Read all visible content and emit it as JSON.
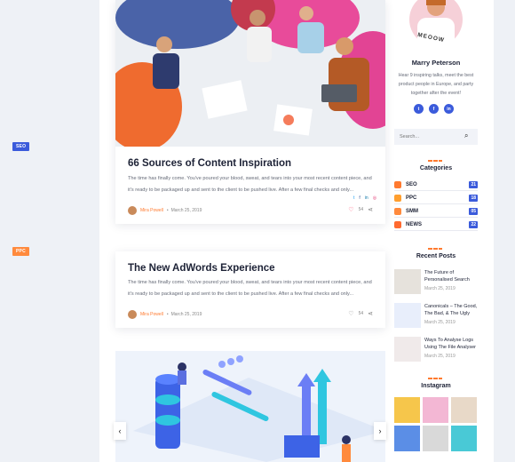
{
  "posts": [
    {
      "category": "SEO",
      "title": "66 Sources of Content Inspiration",
      "excerpt": "The time has finally come. You've poured your blood, sweat, and tears into your most recent content piece, and it's ready to be packaged up and sent to the client to be pushed live. After a few final checks and only...",
      "author": "Mira Powell",
      "date": "March 25, 2019",
      "likes": "54"
    },
    {
      "category": "PPC",
      "title": "The New AdWords Experience",
      "excerpt": "The time has finally come. You've poured your blood, sweat, and tears into your most recent content piece, and it's ready to be packaged up and sent to the client to be pushed live. After a few final checks and only...",
      "author": "Mira Powell",
      "date": "March 25, 2019",
      "likes": "54"
    }
  ],
  "profile": {
    "name": "Marry Peterson",
    "bio": "Hear 9 inspiring talks, meet the best product people in Europe, and party together after the event!",
    "shirt_text": "MEOOW"
  },
  "search": {
    "placeholder": "Search..."
  },
  "categories_title": "Categories",
  "categories": [
    {
      "label": "SEO",
      "count": "21",
      "color": "#ff7a2f"
    },
    {
      "label": "PPC",
      "count": "18",
      "color": "#ff9f2f"
    },
    {
      "label": "SMM",
      "count": "05",
      "color": "#ff8a3d"
    },
    {
      "label": "NEWS",
      "count": "22",
      "color": "#ff6a2f"
    }
  ],
  "recent_title": "Recent Posts",
  "recent": [
    {
      "title": "The Future of Personalised Search",
      "date": "March 25, 2019"
    },
    {
      "title": "Canonicals – The Good, The Bad, & The Ugly",
      "date": "March 25, 2019"
    },
    {
      "title": "Ways To Analyse Logs Using The File Analyser",
      "date": "March 25, 2019"
    }
  ],
  "instagram_title": "Instagram",
  "instagram_colors": [
    "#f6c64b",
    "#f3b7d4",
    "#e8d9c8",
    "#5b8ee6",
    "#d9d9d9",
    "#49c9d6"
  ],
  "colors": {
    "accent": "#ff7a2f",
    "primary": "#3b5bdb"
  }
}
